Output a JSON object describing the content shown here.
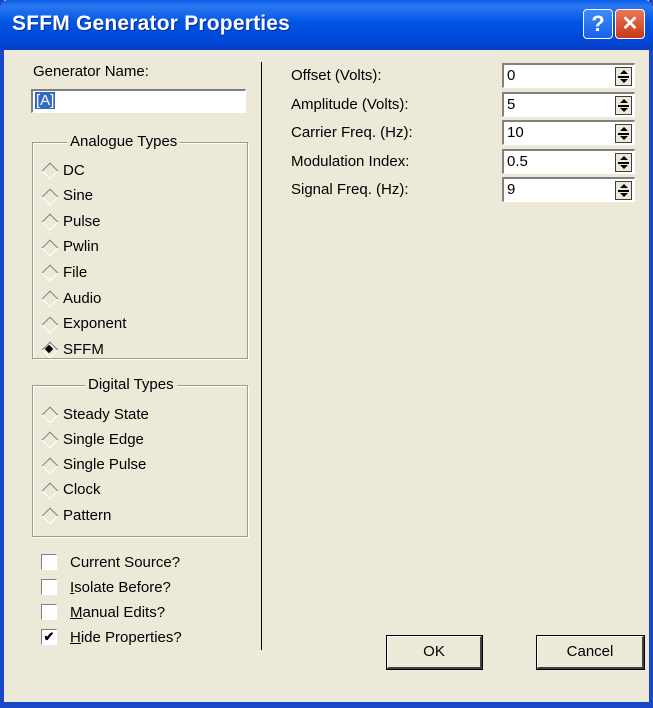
{
  "window": {
    "title": "SFFM Generator Properties",
    "help_glyph": "?",
    "close_glyph": "✕"
  },
  "generator": {
    "name_label": "Generator Name:",
    "name_value": "[A]"
  },
  "analogue": {
    "title": "Analogue Types",
    "selected": "SFFM",
    "items": [
      "DC",
      "Sine",
      "Pulse",
      "Pwlin",
      "File",
      "Audio",
      "Exponent",
      "SFFM"
    ]
  },
  "digital": {
    "title": "Digital Types",
    "items": [
      "Steady State",
      "Single Edge",
      "Single Pulse",
      "Clock",
      "Pattern"
    ]
  },
  "options": [
    {
      "label": "Current Source?",
      "underline": "",
      "rest": "Current Source?",
      "checked": false
    },
    {
      "label": "Isolate Before?",
      "underline": "I",
      "rest": "solate Before?",
      "checked": false
    },
    {
      "label": "Manual Edits?",
      "underline": "M",
      "rest": "anual Edits?",
      "checked": false
    },
    {
      "label": "Hide Properties?",
      "underline": "H",
      "rest": "ide Properties?",
      "checked": true
    }
  ],
  "checkmark_glyph": "✔",
  "fields": [
    {
      "label": "Offset (Volts):",
      "value": "0"
    },
    {
      "label": "Amplitude (Volts):",
      "value": "5"
    },
    {
      "label": "Carrier Freq. (Hz):",
      "value": "10"
    },
    {
      "label": "Modulation Index:",
      "value": "0.5"
    },
    {
      "label": "Signal Freq. (Hz):",
      "value": "9"
    }
  ],
  "buttons": {
    "ok": "OK",
    "cancel": "Cancel"
  }
}
